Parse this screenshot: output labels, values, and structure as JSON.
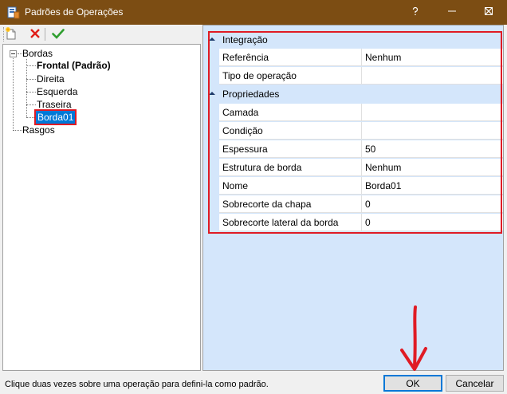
{
  "window": {
    "title": "Padrões de Operações",
    "titlebar_color": "#7c4d13",
    "controls": [
      "help-icon",
      "minimize-icon",
      "maximize-icon",
      "close-icon"
    ]
  },
  "toolbar": {
    "buttons": [
      "new-icon",
      "delete-icon",
      "set-default-icon"
    ]
  },
  "tree": {
    "root": "Bordas",
    "children": [
      "Frontal (Padrão)",
      "Direita",
      "Esquerda",
      "Traseira",
      "Borda01"
    ],
    "selected": "Borda01",
    "second_root": "Rasgos"
  },
  "grid": {
    "categories": [
      {
        "label": "Integração",
        "rows": [
          {
            "name": "Referência",
            "value": "Nenhum"
          },
          {
            "name": "Tipo de operação",
            "value": ""
          }
        ]
      },
      {
        "label": "Propriedades",
        "rows": [
          {
            "name": "Camada",
            "value": ""
          },
          {
            "name": "Condição",
            "value": ""
          },
          {
            "name": "Espessura",
            "value": "50"
          },
          {
            "name": "Estrutura de borda",
            "value": "Nenhum"
          },
          {
            "name": "Nome",
            "value": "Borda01"
          },
          {
            "name": "Sobrecorte da chapa",
            "value": "0"
          },
          {
            "name": "Sobrecorte lateral da borda",
            "value": "0"
          }
        ]
      }
    ]
  },
  "status": {
    "text": "Clique duas vezes sobre uma operação para defini-la como padrão."
  },
  "buttons": {
    "ok": "OK",
    "cancel": "Cancelar"
  },
  "annotation_color": "#e01b24"
}
